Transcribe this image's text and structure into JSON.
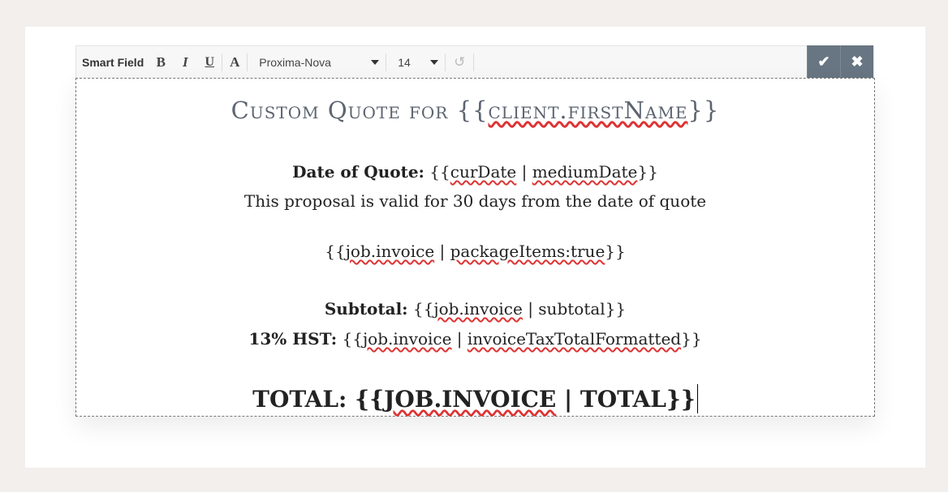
{
  "toolbar": {
    "smart_field": "Smart Field",
    "bold": "B",
    "italic": "I",
    "underline": "U",
    "font_color": "A",
    "font_family": "Proxima-Nova",
    "font_size": "14",
    "undo": "↺",
    "confirm": "✔",
    "close": "✖"
  },
  "document": {
    "title_prefix": "Custom Quote for {{",
    "title_var": "client.firstName",
    "title_suffix": "}}",
    "date_label": "Date of Quote:",
    "date_open": " {{",
    "date_var1": "curDate",
    "date_mid": " | ",
    "date_var2": "mediumDate",
    "date_close": "}}",
    "validity": "This proposal is valid for 30 days from the date of quote",
    "items_open": "{{",
    "items_var1": "job.invoice",
    "items_mid": " | ",
    "items_var2": "packageItems:true",
    "items_close": "}}",
    "subtotal_label": "Subtotal:",
    "subtotal_open": " {{",
    "subtotal_var": "job.invoice",
    "subtotal_rest": " | subtotal}}",
    "hst_label": "13% HST:",
    "hst_open": " {{",
    "hst_var1": "job.invoice",
    "hst_mid": " | ",
    "hst_var2": "invoiceTaxTotalFormatted",
    "hst_close": "}}",
    "total_prefix": "TOTAL: {{",
    "total_var": "JOB.INVOICE",
    "total_rest": " | TOTAL}}"
  },
  "colors": {
    "action_bg": "#687582",
    "title": "#5c6470",
    "spellcheck": "#dd3333"
  }
}
